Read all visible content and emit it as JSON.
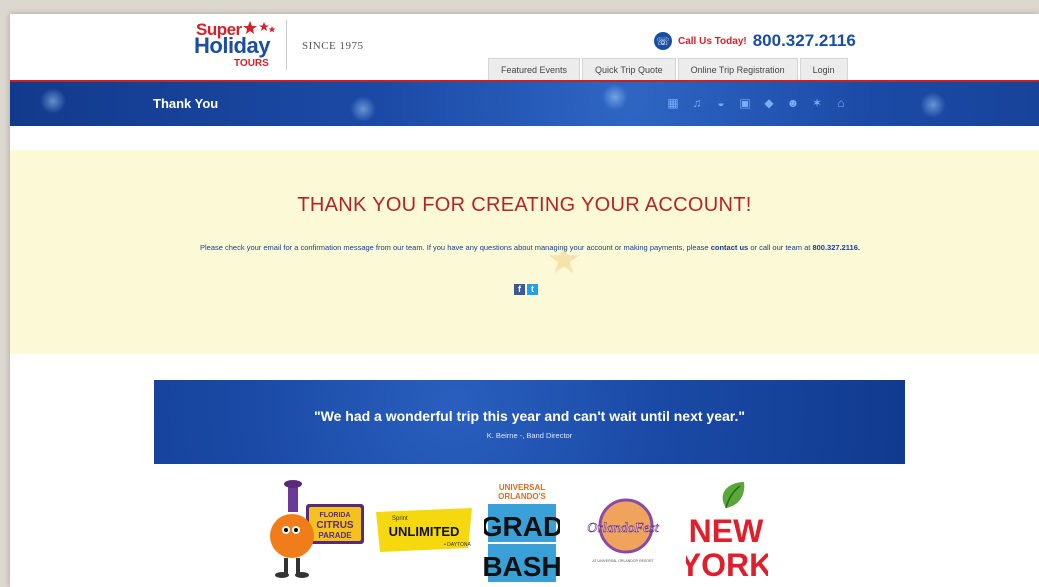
{
  "header": {
    "logo": {
      "line1": "Super",
      "line2": "Holiday",
      "line3": "TOURS"
    },
    "since": "SINCE 1975",
    "call_label": "Call Us Today!",
    "call_number": "800.327.2116",
    "nav": [
      "Featured Events",
      "Quick Trip Quote",
      "Online Trip Registration",
      "Login"
    ]
  },
  "banner": {
    "title": "Thank You",
    "category_icons": [
      "map-icon",
      "music-icon",
      "drum-icon",
      "backpack-icon",
      "graduation-cap-icon",
      "theater-masks-icon",
      "dancer-icon",
      "museum-icon"
    ]
  },
  "main": {
    "heading": "THANK YOU FOR CREATING YOUR ACCOUNT!",
    "message_pre": "Please check your email for a confirmation message from our team. If you have any questions about managing your account or making payments, please",
    "message_link": "contact us",
    "message_post": "or call our team at",
    "message_phone": "800.327.2116."
  },
  "testimonial": {
    "quote": "\"We had a wonderful trip this year and can't wait until next year.\"",
    "author": "K. Beirne -, Band Director"
  },
  "logos": {
    "citrus": {
      "l1": "FLORIDA",
      "l2": "CITRUS",
      "l3": "PARADE"
    },
    "unlimited": {
      "small": "Sprint",
      "main": "UNLIMITED",
      "sub": "• DAYTONA"
    },
    "grad": {
      "top1": "UNIVERSAL",
      "top2": "ORLANDO'S",
      "l1": "GRAD",
      "l2": "BASH"
    },
    "orlandofest": {
      "main": "OrlandoFest",
      "sub": "AT UNIVERSAL ORLANDO® RESORT"
    },
    "newyork": {
      "l1": "NEW",
      "l2": "YORK"
    }
  },
  "colors": {
    "brand_blue": "#1a4ea3",
    "brand_red": "#d6202a",
    "cream": "#fbf9d6"
  }
}
